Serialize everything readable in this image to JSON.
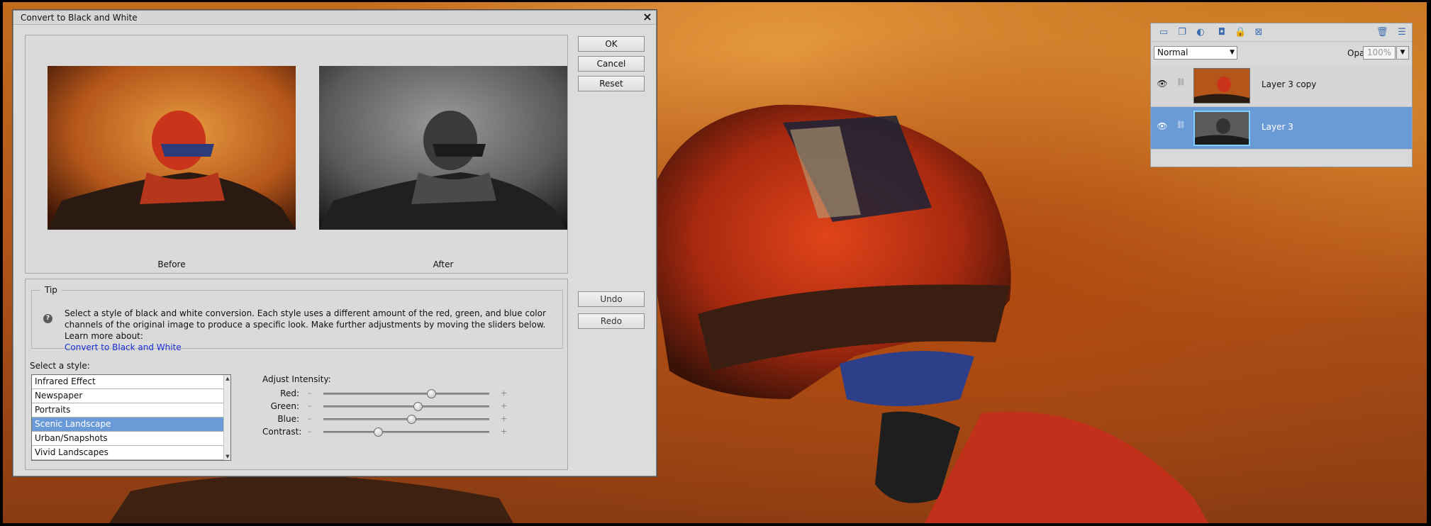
{
  "dialog": {
    "title": "Convert to Black and White",
    "buttons": {
      "ok": "OK",
      "cancel": "Cancel",
      "reset": "Reset",
      "undo": "Undo",
      "redo": "Redo"
    },
    "preview": {
      "before_label": "Before",
      "after_label": "After"
    },
    "tip": {
      "heading": "Tip",
      "text": "Select a style of black and white conversion. Each style uses a different amount of the red, green, and blue color channels of the original image to produce a specific look. Make further adjustments by moving the sliders below. Learn more about:",
      "link": "Convert to Black and White"
    },
    "style": {
      "label": "Select a style:",
      "items": [
        "Infrared Effect",
        "Newspaper",
        "Portraits",
        "Scenic Landscape",
        "Urban/Snapshots",
        "Vivid Landscapes"
      ],
      "selected_index": 3
    },
    "intensity": {
      "label": "Adjust Intensity:",
      "minus": "–",
      "plus": "+",
      "sliders": [
        {
          "name": "Red:",
          "value": 0.65
        },
        {
          "name": "Green:",
          "value": 0.57
        },
        {
          "name": "Blue:",
          "value": 0.53
        },
        {
          "name": "Contrast:",
          "value": 0.33
        }
      ]
    }
  },
  "layers_panel": {
    "blend_mode": "Normal",
    "opacity_label": "Opacity:",
    "opacity_value": "100%",
    "layers": [
      {
        "name": "Layer 3 copy",
        "selected": false
      },
      {
        "name": "Layer 3",
        "selected": true
      }
    ]
  },
  "colors": {
    "selection": "#6b9bd6",
    "link": "#1a2fd6",
    "photo_orange": "#c26b1c"
  }
}
